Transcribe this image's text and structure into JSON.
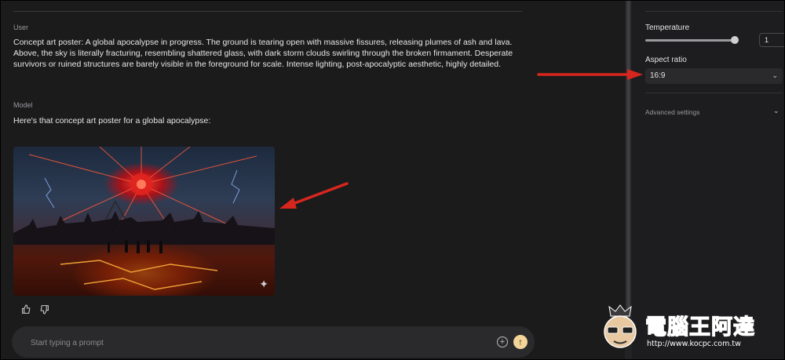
{
  "conversation": {
    "user": {
      "role_label": "User",
      "text": "Concept art poster: A global apocalypse in progress. The ground is tearing open with massive fissures, releasing plumes of ash and lava. Above, the sky is literally fracturing, resembling shattered glass, with dark storm clouds swirling through the broken firmament. Desperate survivors or ruined structures are barely visible in the foreground for scale. Intense lighting, post-apocalyptic aesthetic, highly detailed."
    },
    "model": {
      "role_label": "Model",
      "text": "Here's that concept art poster for a global apocalypse:",
      "image_icon": "sparkle-icon"
    },
    "feedback": {
      "like_icon": "thumbs-up-icon",
      "dislike_icon": "thumbs-down-icon"
    }
  },
  "prompt": {
    "placeholder": "Start typing a prompt",
    "add_icon": "add-circle-icon",
    "send_icon": "arrow-up-icon"
  },
  "settings": {
    "temperature_label": "Temperature",
    "temperature_value": "1",
    "temperature_fraction": 0.9,
    "aspect_ratio_label": "Aspect ratio",
    "aspect_ratio_value": "16:9",
    "advanced_label": "Advanced settings"
  },
  "watermark": {
    "text": "電腦王阿達",
    "url": "http://www.kocpc.com.tw"
  },
  "colors": {
    "annotation_arrow": "#d7261e",
    "send_button": "#f3d59a",
    "background": "#1b1b1c"
  }
}
